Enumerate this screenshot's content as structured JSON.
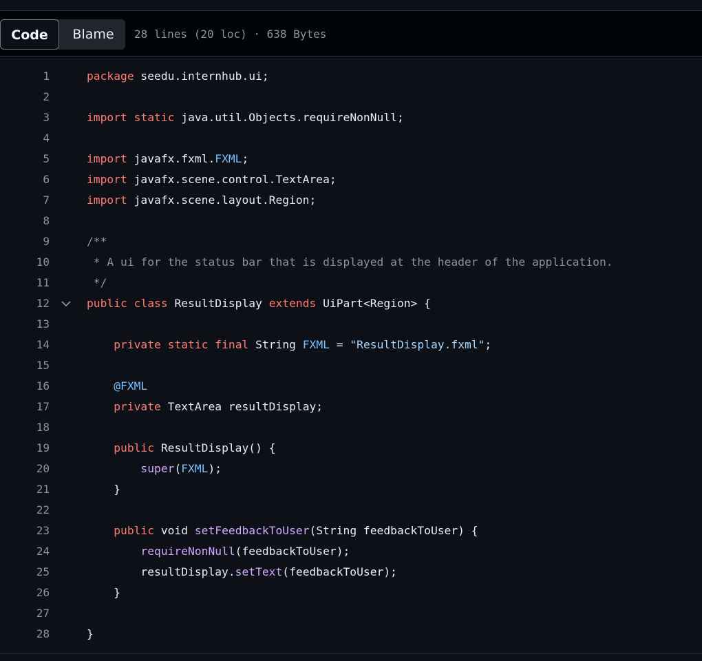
{
  "toolbar": {
    "code_label": "Code",
    "blame_label": "Blame",
    "file_info": "28 lines (20 loc) · 638 Bytes"
  },
  "colors": {
    "keyword": "#ff7b72",
    "constant": "#79c0ff",
    "string": "#a5d6ff",
    "function": "#d2a8ff",
    "comment": "#8b949e",
    "text": "#e6edf3",
    "line_number": "#8b949e"
  },
  "code": {
    "lines": [
      {
        "number": "1",
        "segments": [
          {
            "t": "package",
            "c": "kw"
          },
          {
            "t": " seedu.internhub.ui;",
            "c": ""
          }
        ]
      },
      {
        "number": "2",
        "segments": []
      },
      {
        "number": "3",
        "segments": [
          {
            "t": "import",
            "c": "kw"
          },
          {
            "t": " ",
            "c": ""
          },
          {
            "t": "static",
            "c": "kw"
          },
          {
            "t": " java.util.Objects.requireNonNull;",
            "c": ""
          }
        ]
      },
      {
        "number": "4",
        "segments": []
      },
      {
        "number": "5",
        "segments": [
          {
            "t": "import",
            "c": "kw"
          },
          {
            "t": " javafx.fxml.",
            "c": ""
          },
          {
            "t": "FXML",
            "c": "cn"
          },
          {
            "t": ";",
            "c": ""
          }
        ]
      },
      {
        "number": "6",
        "segments": [
          {
            "t": "import",
            "c": "kw"
          },
          {
            "t": " javafx.scene.control.TextArea;",
            "c": ""
          }
        ]
      },
      {
        "number": "7",
        "segments": [
          {
            "t": "import",
            "c": "kw"
          },
          {
            "t": " javafx.scene.layout.Region;",
            "c": ""
          }
        ]
      },
      {
        "number": "8",
        "segments": []
      },
      {
        "number": "9",
        "segments": [
          {
            "t": "/**",
            "c": "cm"
          }
        ]
      },
      {
        "number": "10",
        "segments": [
          {
            "t": " * A ui for the status bar that is displayed at the header of the application.",
            "c": "cm"
          }
        ]
      },
      {
        "number": "11",
        "segments": [
          {
            "t": " */",
            "c": "cm"
          }
        ]
      },
      {
        "number": "12",
        "fold": true,
        "segments": [
          {
            "t": "public",
            "c": "kw"
          },
          {
            "t": " ",
            "c": ""
          },
          {
            "t": "class",
            "c": "kw"
          },
          {
            "t": " ResultDisplay ",
            "c": ""
          },
          {
            "t": "extends",
            "c": "kw"
          },
          {
            "t": " UiPart<Region> {",
            "c": ""
          }
        ]
      },
      {
        "number": "13",
        "segments": []
      },
      {
        "number": "14",
        "segments": [
          {
            "t": "    ",
            "c": ""
          },
          {
            "t": "private",
            "c": "kw"
          },
          {
            "t": " ",
            "c": ""
          },
          {
            "t": "static",
            "c": "kw"
          },
          {
            "t": " ",
            "c": ""
          },
          {
            "t": "final",
            "c": "kw"
          },
          {
            "t": " String ",
            "c": ""
          },
          {
            "t": "FXML",
            "c": "cn"
          },
          {
            "t": " = ",
            "c": ""
          },
          {
            "t": "\"ResultDisplay.fxml\"",
            "c": "st"
          },
          {
            "t": ";",
            "c": ""
          }
        ]
      },
      {
        "number": "15",
        "segments": []
      },
      {
        "number": "16",
        "segments": [
          {
            "t": "    ",
            "c": ""
          },
          {
            "t": "@FXML",
            "c": "cn"
          }
        ]
      },
      {
        "number": "17",
        "segments": [
          {
            "t": "    ",
            "c": ""
          },
          {
            "t": "private",
            "c": "kw"
          },
          {
            "t": " TextArea resultDisplay;",
            "c": ""
          }
        ]
      },
      {
        "number": "18",
        "segments": []
      },
      {
        "number": "19",
        "segments": [
          {
            "t": "    ",
            "c": ""
          },
          {
            "t": "public",
            "c": "kw"
          },
          {
            "t": " ResultDisplay() {",
            "c": ""
          }
        ]
      },
      {
        "number": "20",
        "segments": [
          {
            "t": "        ",
            "c": ""
          },
          {
            "t": "super",
            "c": "fn"
          },
          {
            "t": "(",
            "c": ""
          },
          {
            "t": "FXML",
            "c": "cn"
          },
          {
            "t": ");",
            "c": ""
          }
        ]
      },
      {
        "number": "21",
        "segments": [
          {
            "t": "    }",
            "c": ""
          }
        ]
      },
      {
        "number": "22",
        "segments": []
      },
      {
        "number": "23",
        "segments": [
          {
            "t": "    ",
            "c": ""
          },
          {
            "t": "public",
            "c": "kw"
          },
          {
            "t": " void ",
            "c": ""
          },
          {
            "t": "setFeedbackToUser",
            "c": "fn"
          },
          {
            "t": "(String feedbackToUser) {",
            "c": ""
          }
        ]
      },
      {
        "number": "24",
        "segments": [
          {
            "t": "        ",
            "c": ""
          },
          {
            "t": "requireNonNull",
            "c": "fn"
          },
          {
            "t": "(feedbackToUser);",
            "c": ""
          }
        ]
      },
      {
        "number": "25",
        "segments": [
          {
            "t": "        resultDisplay.",
            "c": ""
          },
          {
            "t": "setText",
            "c": "fn"
          },
          {
            "t": "(feedbackToUser);",
            "c": ""
          }
        ]
      },
      {
        "number": "26",
        "segments": [
          {
            "t": "    }",
            "c": ""
          }
        ]
      },
      {
        "number": "27",
        "segments": []
      },
      {
        "number": "28",
        "segments": [
          {
            "t": "}",
            "c": ""
          }
        ]
      }
    ]
  }
}
